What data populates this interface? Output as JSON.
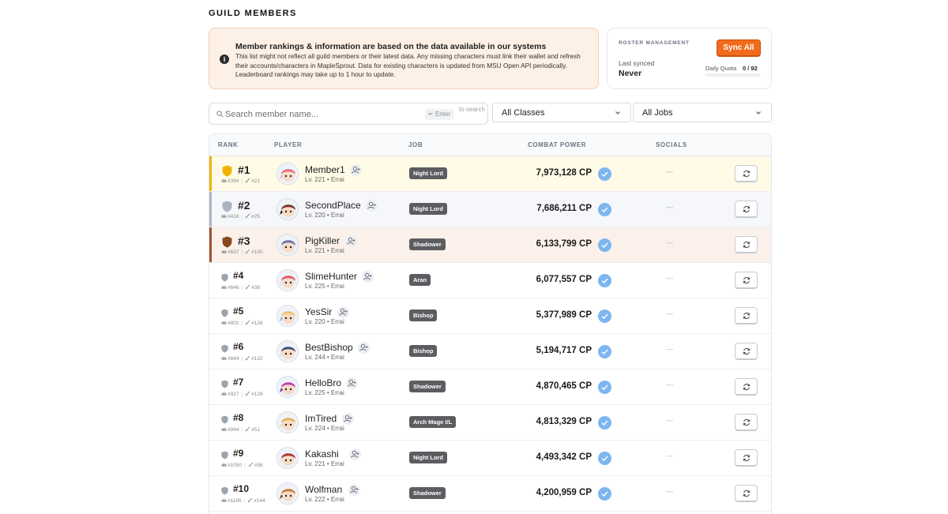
{
  "page": {
    "title": "GUILD MEMBERS"
  },
  "notice": {
    "title": "Member rankings & information are based on the data available in our systems",
    "body": "This list might not reflect all guild members or their latest data. Any missing characters must link their wallet and refresh their accounts/characters in MapleSprout. Data for existing characters is updated from MSU Open API periodically. Leaderboard rankings may take up to 1 hour to update.",
    "icon": "info-icon"
  },
  "roster": {
    "label": "ROSTER MANAGEMENT",
    "sync_label": "Sync All",
    "last_synced_label": "Last synced",
    "last_synced_value": "Never",
    "quota_label": "Daily Quota",
    "quota_value": "0 / 92",
    "accent": "#f26a1b"
  },
  "search": {
    "placeholder": "Search member name...",
    "enter_hint": "↵ Enter",
    "to_search": "to search"
  },
  "filters": {
    "classes": "All Classes",
    "jobs": "All Jobs"
  },
  "table": {
    "headers": {
      "rank": "RANK",
      "player": "PLAYER",
      "job": "JOB",
      "combat_power": "COMBAT POWER",
      "socials": "SOCIALS"
    },
    "rows": [
      {
        "rank": "#1",
        "tier": "gold",
        "r1": "#394",
        "r2": "#21",
        "name": "Member1",
        "meta": "Lv. 221 • Errai",
        "job": "Night Lord",
        "cp": "7,973,128 CP",
        "socials": "—"
      },
      {
        "rank": "#2",
        "tier": "silver",
        "r1": "#418",
        "r2": "#25",
        "name": "SecondPlace",
        "meta": "Lv. 220 • Errai",
        "job": "Night Lord",
        "cp": "7,686,211 CP",
        "socials": "—"
      },
      {
        "rank": "#3",
        "tier": "bronze",
        "r1": "#637",
        "r2": "#100",
        "name": "PigKiller",
        "meta": "Lv. 221 • Errai",
        "job": "Shadower",
        "cp": "6,133,799 CP",
        "socials": "—"
      },
      {
        "rank": "#4",
        "tier": "none",
        "r1": "#646",
        "r2": "#38",
        "name": "SlimeHunter",
        "meta": "Lv. 225 • Errai",
        "job": "Aran",
        "cp": "6,077,557 CP",
        "socials": "—"
      },
      {
        "rank": "#5",
        "tier": "none",
        "r1": "#802",
        "r2": "#126",
        "name": "YesSir",
        "meta": "Lv. 220 • Errai",
        "job": "Bishop",
        "cp": "5,377,989 CP",
        "socials": "—"
      },
      {
        "rank": "#6",
        "tier": "none",
        "r1": "#844",
        "r2": "#132",
        "name": "BestBishop",
        "meta": "Lv. 244 • Errai",
        "job": "Bishop",
        "cp": "5,194,717 CP",
        "socials": "—"
      },
      {
        "rank": "#7",
        "tier": "none",
        "r1": "#927",
        "r2": "#126",
        "name": "HelloBro",
        "meta": "Lv. 225 • Errai",
        "job": "Shadower",
        "cp": "4,870,465 CP",
        "socials": "—"
      },
      {
        "rank": "#8",
        "tier": "none",
        "r1": "#944",
        "r2": "#51",
        "name": "ImTired",
        "meta": "Lv. 224 • Errai",
        "job": "Arch Mage I/L",
        "cp": "4,813,329 CP",
        "socials": "—"
      },
      {
        "rank": "#9",
        "tier": "none",
        "r1": "#1050",
        "r2": "#56",
        "name": "Kakashi",
        "meta": "Lv. 221 • Errai",
        "job": "Night Lord",
        "cp": "4,493,342 CP",
        "socials": "—"
      },
      {
        "rank": "#10",
        "tier": "none",
        "r1": "#1165",
        "r2": "#144",
        "name": "Wolfman",
        "meta": "Lv. 222 • Errai",
        "job": "Shadower",
        "cp": "4,200,959 CP",
        "socials": "—"
      }
    ]
  },
  "colors": {
    "gold": "#f0b400",
    "silver": "#aab4c2",
    "bronze": "#a0522d",
    "plain_shield": "#9aa3ae",
    "verified": "#7cb6f0",
    "job_badge": "#5b5d61"
  }
}
